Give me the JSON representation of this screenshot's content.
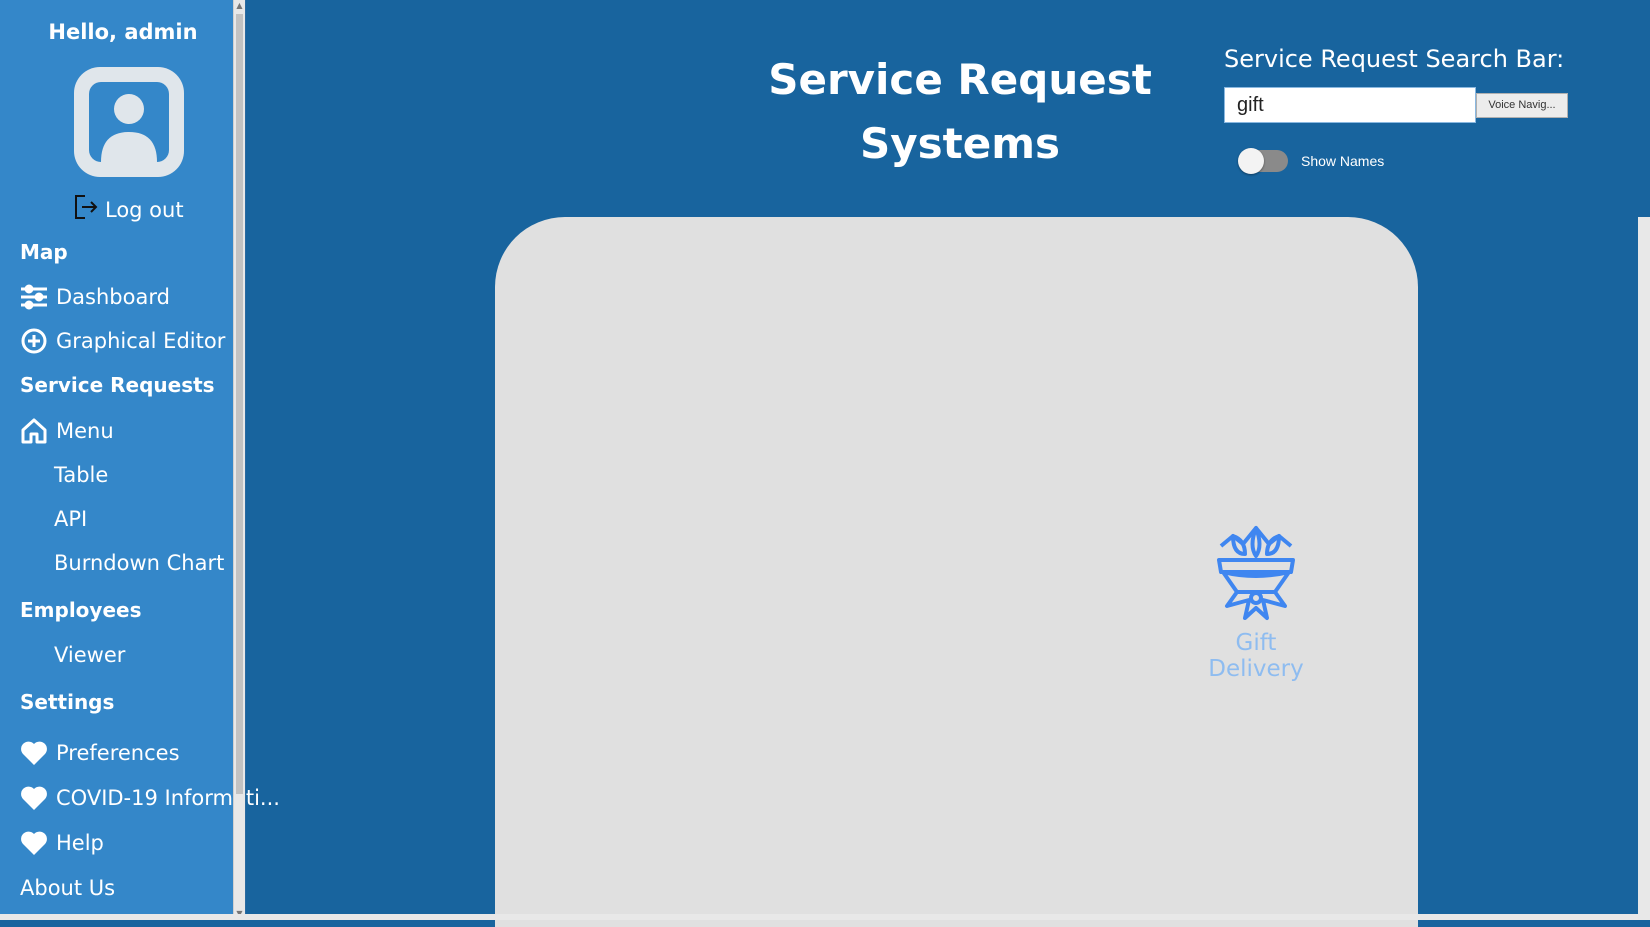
{
  "sidebar": {
    "greeting": "Hello, admin",
    "logout_label": "Log out",
    "sections": [
      {
        "heading": "Map"
      },
      {
        "heading": "Service Requests"
      },
      {
        "heading": "Employees"
      },
      {
        "heading": "Settings"
      }
    ],
    "items": {
      "dashboard": "Dashboard",
      "graphical_editor": "Graphical Editor",
      "menu": "Menu",
      "table": "Table",
      "api": "API",
      "burndown_chart": "Burndown Chart",
      "viewer": "Viewer",
      "preferences": "Preferences",
      "covid": "COVID-19 Informati...",
      "help": "Help",
      "about_us": "About Us"
    }
  },
  "header": {
    "title": "Service Request Systems",
    "search_label": "Service Request Search Bar:",
    "search_value": "gift",
    "voice_button": "Voice Navig...",
    "toggle_label": "Show Names",
    "toggle_on": false
  },
  "map": {
    "results": [
      {
        "label": "Gift Delivery",
        "icon": "flower-bouquet-icon"
      }
    ]
  },
  "colors": {
    "background": "#18649e",
    "sidebar": "#3487c9",
    "panel": "#e0e0e0",
    "icon_blue": "#3f86f0"
  }
}
